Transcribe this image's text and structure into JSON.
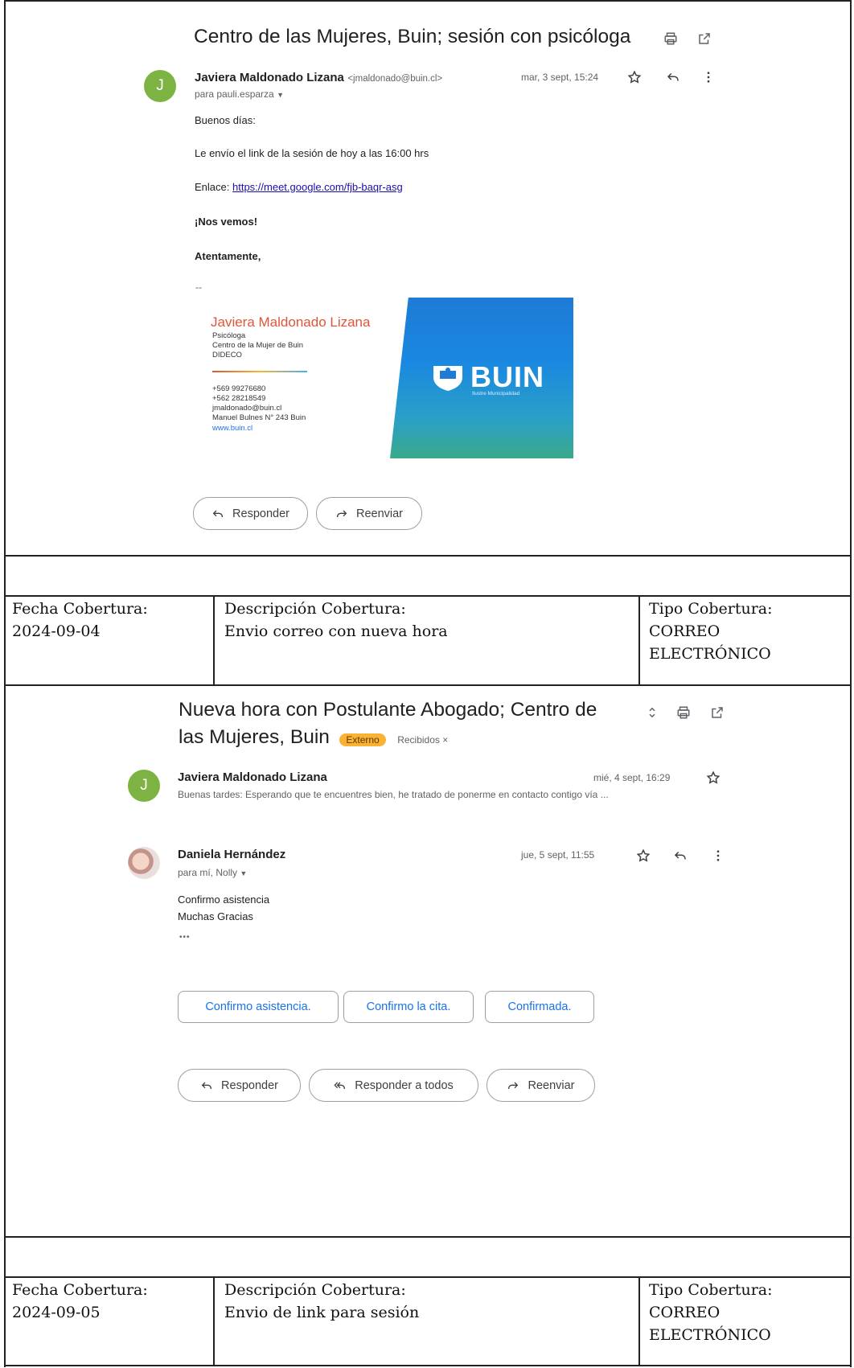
{
  "email1": {
    "subject": "Centro de las Mujeres, Buin; sesión con psicóloga",
    "avatar_initial": "J",
    "sender_name": "Javiera Maldonado Lizana",
    "sender_email": "<jmaldonado@buin.cl>",
    "recipient": "para pauli.esparza",
    "date": "mar, 3 sept, 15:24",
    "greeting": "Buenos días:",
    "line1": "Le envío el link de la sesión de hoy a las 16:00 hrs",
    "link_label": "Enlace:",
    "link_url": "https://meet.google.com/fjb-baqr-asg",
    "closing1": "¡Nos vemos!",
    "closing2": "Atentamente,",
    "separator": "--",
    "signature": {
      "name": "Javiera Maldonado Lizana",
      "role": "Psicóloga",
      "org": "Centro de la Mujer de Buin",
      "dept": "DIDECO",
      "phone1": "+569 99276680",
      "phone2": "+562 28218549",
      "email": "jmaldonado@buin.cl",
      "address": "Manuel Bulnes N° 243 Buin",
      "web": "www.buin.cl"
    },
    "banner": {
      "logo_text": "BUIN",
      "subtext": "Ilustre Municipalidad"
    },
    "buttons": {
      "reply": "Responder",
      "forward": "Reenviar"
    }
  },
  "row1": {
    "fecha_label": "Fecha Cobertura:",
    "fecha_value": "2024-09-04",
    "desc_label": "Descripción Cobertura:",
    "desc_value": "Envio correo con nueva hora",
    "tipo_label": "Tipo Cobertura:",
    "tipo_value1": "CORREO",
    "tipo_value2": "ELECTRÓNICO"
  },
  "email2": {
    "subject_line1": "Nueva hora con Postulante Abogado; Centro de",
    "subject_line2": "las Mujeres, Buin",
    "badge_external": "Externo",
    "badge_inbox": "Recibidos ×",
    "msg1": {
      "avatar_initial": "J",
      "sender_name": "Javiera Maldonado Lizana",
      "date": "mié, 4 sept, 16:29",
      "snippet": "Buenas tardes: Esperando que te encuentres bien, he tratado de ponerme en contacto contigo vía ..."
    },
    "msg2": {
      "sender_name": "Daniela Hernández",
      "recipient": "para mí, Nolly",
      "date": "jue, 5 sept, 11:55",
      "body1": "Confirmo asistencia",
      "body2": "Muchas Gracias",
      "ellipsis": "•••"
    },
    "smart_replies": [
      "Confirmo asistencia.",
      "Confirmo la cita.",
      "Confirmada."
    ],
    "buttons": {
      "reply": "Responder",
      "reply_all": "Responder a todos",
      "forward": "Reenviar"
    }
  },
  "row2": {
    "fecha_label": "Fecha Cobertura:",
    "fecha_value": "2024-09-05",
    "desc_label": "Descripción Cobertura:",
    "desc_value": "Envio de link para sesión",
    "tipo_label": "Tipo Cobertura:",
    "tipo_value1": "CORREO",
    "tipo_value2": "ELECTRÓNICO"
  }
}
